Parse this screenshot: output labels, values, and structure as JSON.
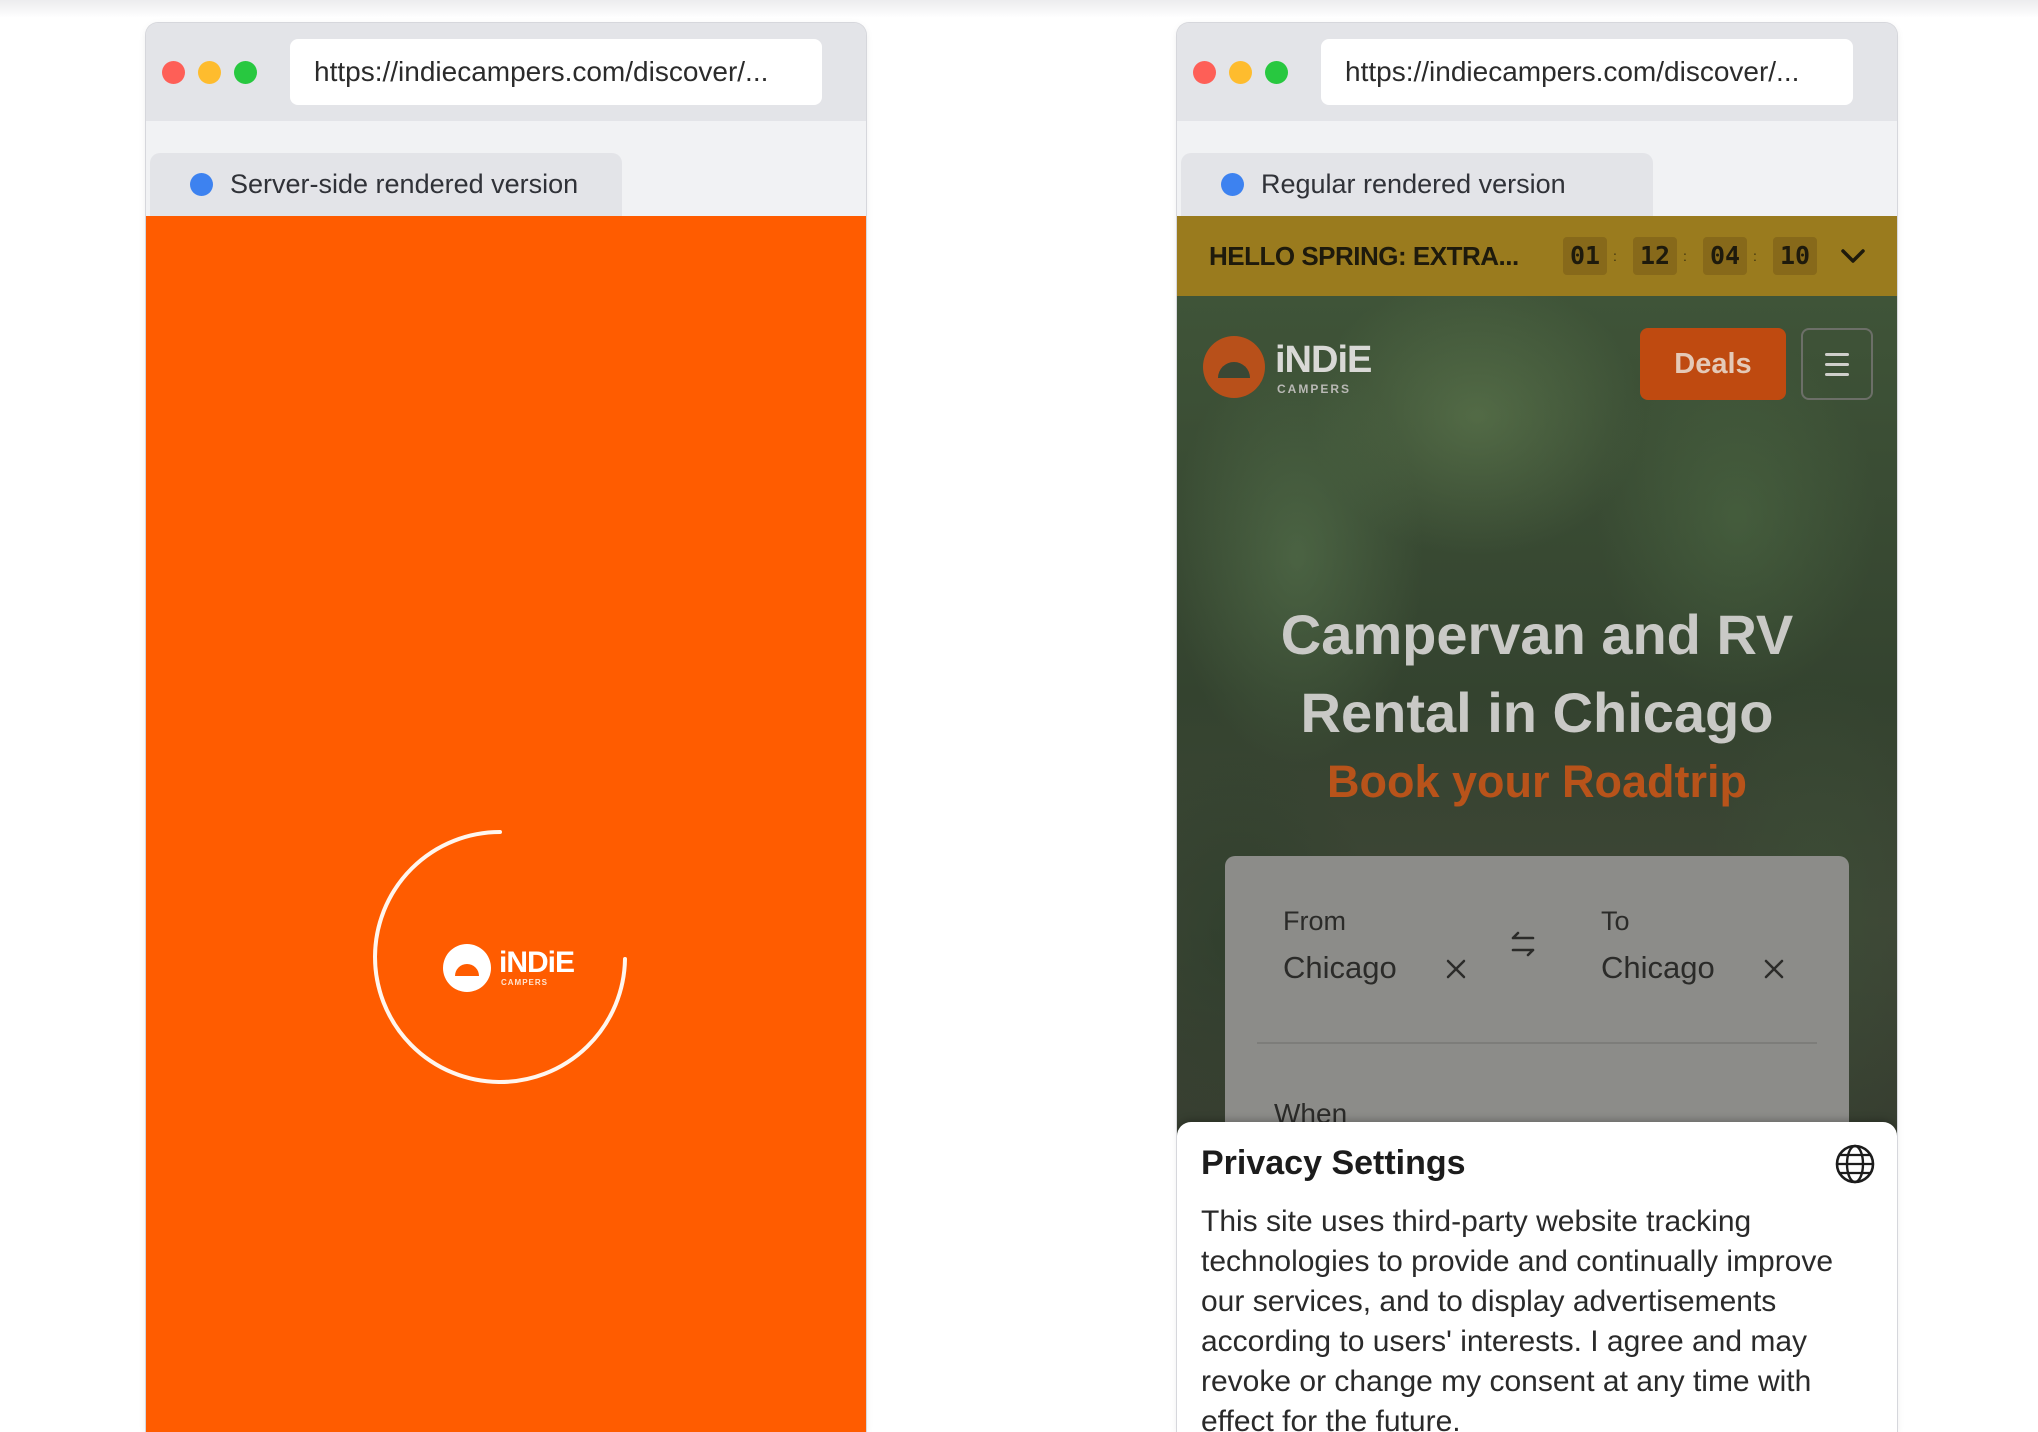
{
  "left": {
    "url": "https://indiecampers.com/discover/...",
    "tab_label": "Server-side rendered version",
    "logo_text": "iNDiE",
    "logo_sub": "CAMPERS",
    "colors": {
      "background": "#ff5c00",
      "spinner": "#ffffff"
    }
  },
  "right": {
    "url": "https://indiecampers.com/discover/...",
    "tab_label": "Regular rendered version",
    "promo": {
      "text": "HELLO SPRING: EXTRA...",
      "timer": [
        "01",
        "12",
        "04",
        "10"
      ],
      "separator": ":"
    },
    "nav": {
      "logo_text": "iNDiE",
      "logo_sub": "CAMPERS",
      "deals_label": "Deals"
    },
    "hero": {
      "title_line1": "Campervan and RV",
      "title_line2": "Rental in Chicago",
      "subtitle": "Book your Roadtrip"
    },
    "search": {
      "from_label": "From",
      "from_value": "Chicago",
      "to_label": "To",
      "to_value": "Chicago",
      "when_label": "When"
    },
    "privacy": {
      "title": "Privacy Settings",
      "body": "This site uses third-party website tracking technologies to provide and continually improve our services, and to display advertisements according to users' interests. I agree and may revoke or change my consent at any time with effect for the future."
    },
    "colors": {
      "promo": "#9a7b1e",
      "deals": "#bf4a10",
      "accent": "#b8531a"
    }
  },
  "icons": {
    "window_controls": [
      "close-dot",
      "minimize-dot",
      "maximize-dot"
    ],
    "tab_indicator": "blue-dot-icon",
    "promo_toggle": "chevron-down-icon",
    "menu": "hamburger-menu-icon",
    "swap": "swap-arrows-icon",
    "clear": "close-x-icon",
    "language": "globe-icon",
    "loader": "loading-spinner-icon"
  }
}
